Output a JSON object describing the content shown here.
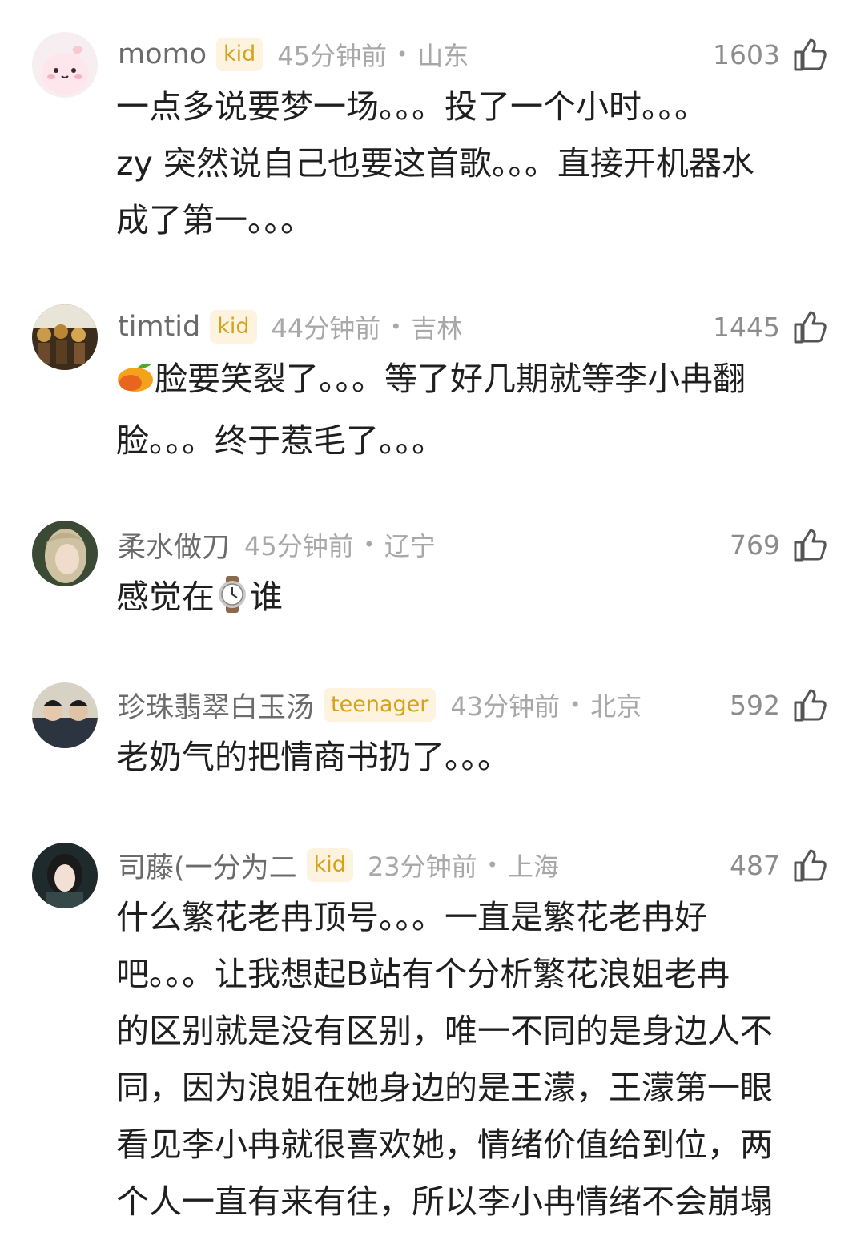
{
  "comments": [
    {
      "username": "momo",
      "badge": "kid",
      "time": "45分钟前",
      "sep": "•",
      "location": "山东",
      "likes": "1603",
      "lines": [
        "一点多说要梦一场。。。投了一个小时。。。",
        "zy 突然说自己也要这首歌。。。直接开机器水",
        "成了第一。。。"
      ]
    },
    {
      "username": "timtid",
      "badge": "kid",
      "time": "44分钟前",
      "sep": "•",
      "location": "吉林",
      "likes": "1445",
      "line1_rest": "脸要笑裂了。。。等了好几期就等李小冉翻",
      "line2": "脸。。。终于惹毛了。。。"
    },
    {
      "username": "柔水做刀",
      "time": "45分钟前",
      "sep": "•",
      "location": "辽宁",
      "likes": "769",
      "text_before": "感觉在",
      "text_after": "谁"
    },
    {
      "username": "珍珠翡翠白玉汤",
      "badge": "teenager",
      "time": "43分钟前",
      "sep": "•",
      "location": "北京",
      "likes": "592",
      "lines": [
        "老奶气的把情商书扔了。。。"
      ]
    },
    {
      "username": "司藤(一分为二",
      "badge": "kid",
      "time": "23分钟前",
      "sep": "•",
      "location": "上海",
      "likes": "487",
      "lines": [
        "什么繁花老冉顶号。。。一直是繁花老冉好",
        "吧。。。让我想起B站有个分析繁花浪姐老冉",
        "的区别就是没有区别，唯一不同的是身边人不",
        "同，因为浪姐在她身边的是王濛，王濛第一眼",
        "看见李小冉就很喜欢她，情绪价值给到位，两",
        "个人一直有来有往，所以李小冉情绪不会崩塌"
      ]
    }
  ],
  "icons": {
    "like": "thumbs-up-icon",
    "mango": "mango-emoji",
    "watch": "watch-emoji"
  },
  "colors": {
    "badge_text": "#d6a21c",
    "badge_bg": "#fdf3df",
    "meta": "#a8a8a8"
  }
}
